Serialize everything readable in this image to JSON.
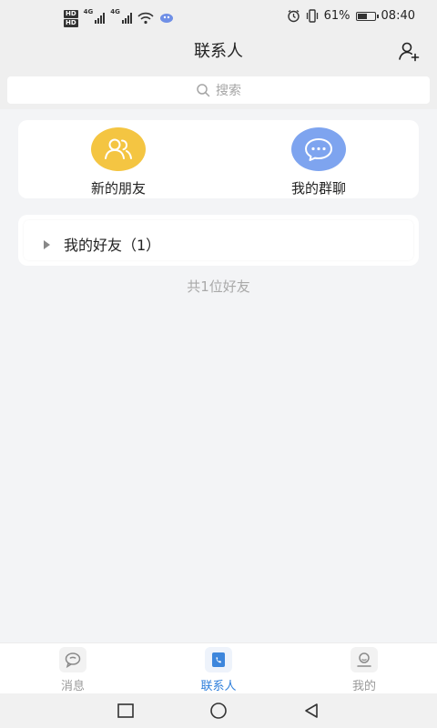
{
  "status_bar": {
    "hd_top": "HD",
    "hd_bottom": "HD",
    "net1": "4G",
    "net2": "4G",
    "battery_percent": "61%",
    "battery_level": 0.61,
    "time": "08:40"
  },
  "header": {
    "title": "联系人"
  },
  "search": {
    "placeholder": "搜索"
  },
  "quick_actions": [
    {
      "label": "新的朋友",
      "color": "#f4c542"
    },
    {
      "label": "我的群聊",
      "color": "#7ea4ef"
    }
  ],
  "friends_group": {
    "label": "我的好友（1）"
  },
  "friend_count": "共1位好友",
  "tabs": [
    {
      "label": "消息"
    },
    {
      "label": "联系人"
    },
    {
      "label": "我的"
    }
  ],
  "colors": {
    "accent": "#2f7fdb"
  }
}
